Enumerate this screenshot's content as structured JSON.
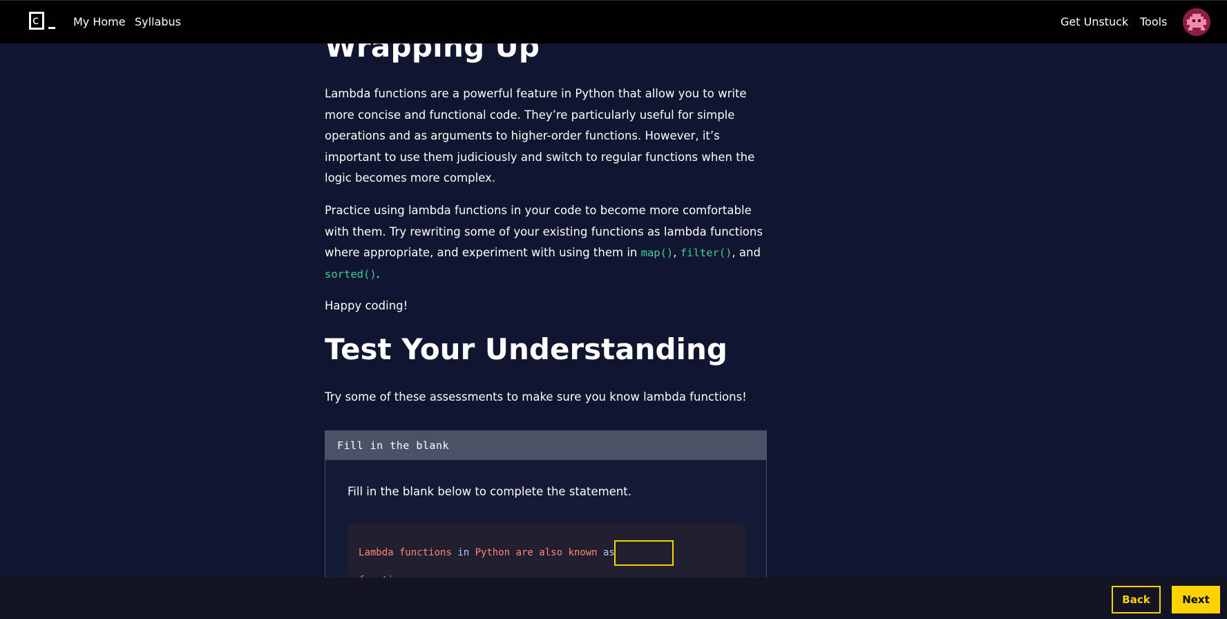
{
  "nav": {
    "logo_letter": "c",
    "my_home": "My Home",
    "syllabus": "Syllabus",
    "get_unstuck": "Get Unstuck",
    "tools": "Tools"
  },
  "article": {
    "heading_wrap": "Wrapping Up",
    "para1": "Lambda functions are a powerful feature in Python that allow you to write more concise and functional code. They’re particularly useful for simple operations and as arguments to higher-order functions. However, it’s important to use them judiciously and switch to regular functions when the logic becomes more complex.",
    "para2_intro": "Practice using lambda functions in your code to become more comfortable with them. Try rewriting some of your existing functions as lambda functions where appropriate, and experiment with using them in ",
    "code_map": "map()",
    "comma": ", ",
    "code_filter": "filter()",
    "and_text": ", and",
    "code_sorted": "sorted()",
    "period": ".",
    "para3": "Happy coding!",
    "heading_test": "Test Your Understanding",
    "test_intro": "Try some of these assessments to make sure you know lambda functions!"
  },
  "assessment": {
    "header": "Fill in the blank",
    "instruction": "Fill in the blank below to complete the statement.",
    "code_tokens": {
      "t1": "Lambda functions",
      "t2": "in",
      "t3": "Python are also known",
      "t4": "as"
    },
    "code_line2": "functions."
  },
  "footer": {
    "back": "Back",
    "next": "Next"
  },
  "colors": {
    "accent": "#ffd300",
    "code_green": "#34d399",
    "background": "#10162f"
  }
}
